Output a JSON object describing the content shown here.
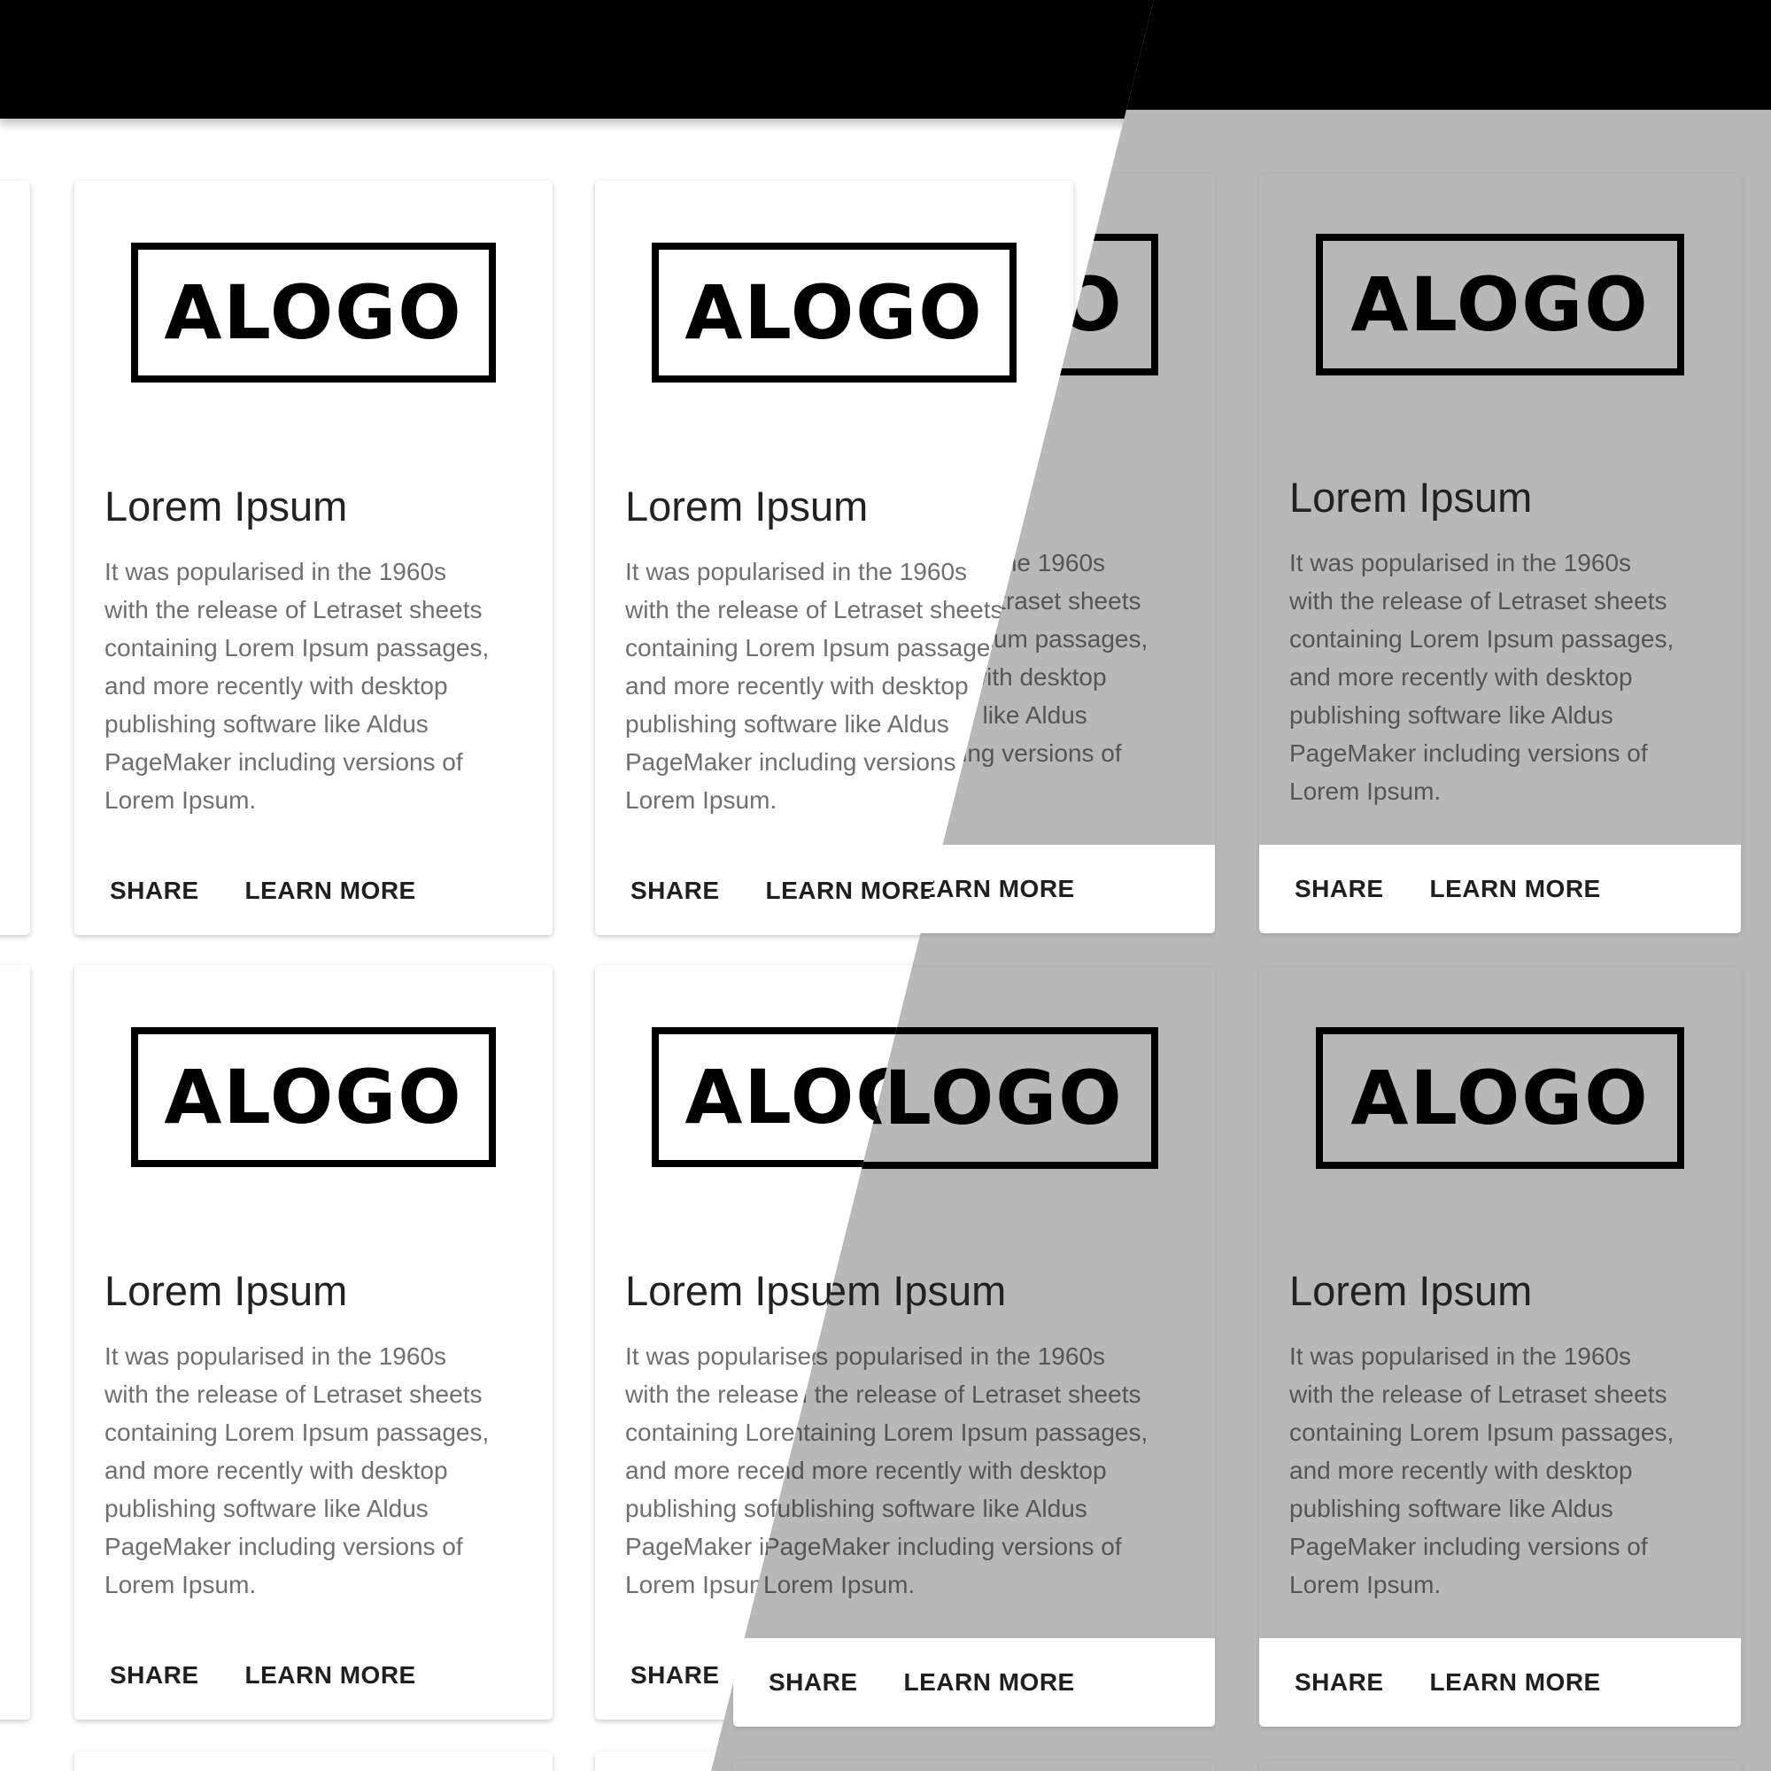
{
  "cards": [
    {
      "logo_text": "ALOGO",
      "title": "Lorem Ipsum",
      "body_lines": [
        "It was popularised in the 1960s",
        "with the release of Letraset sheets",
        "containing Lorem Ipsum passages,",
        "and more recently with desktop",
        "publishing software like Aldus",
        "PageMaker including versions of",
        "Lorem Ipsum."
      ],
      "actions": {
        "share": "SHARE",
        "learn_more": "LEARN MORE"
      }
    }
  ]
}
